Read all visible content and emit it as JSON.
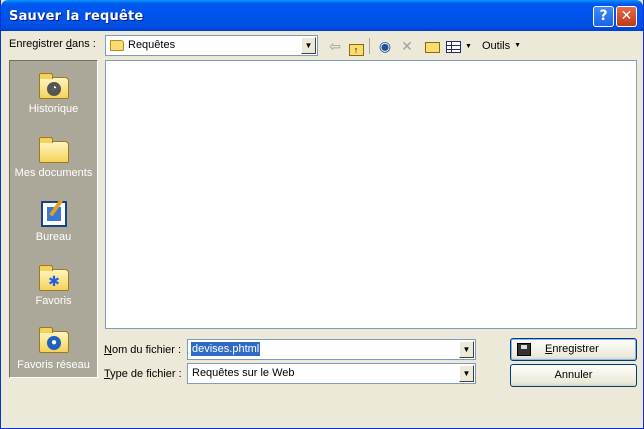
{
  "window": {
    "title": "Sauver la requête"
  },
  "titlebar_buttons": {
    "help": "?",
    "close": "✕"
  },
  "lookin": {
    "label_pre": "Enregistrer ",
    "label_key": "d",
    "label_post": "ans :",
    "value": "Requêtes"
  },
  "toolbar": {
    "tools_label": "Outils"
  },
  "places": [
    {
      "label": "Historique",
      "icon": "history-icon"
    },
    {
      "label": "Mes documents",
      "icon": "my-documents-icon"
    },
    {
      "label": "Bureau",
      "icon": "desktop-icon"
    },
    {
      "label": "Favoris",
      "icon": "favorites-icon"
    },
    {
      "label": "Favoris réseau",
      "icon": "network-favorites-icon"
    }
  ],
  "filename": {
    "label_key": "N",
    "label_post": "om du fichier :",
    "value": "devises.phtml"
  },
  "filetype": {
    "label_key": "T",
    "label_post": "ype de fichier :",
    "value": "Requêtes sur le Web"
  },
  "buttons": {
    "save_key": "E",
    "save_post": "nregistrer",
    "cancel": "Annuler"
  },
  "colors": {
    "titlebar": "#0053ee",
    "places_bg": "#aca899",
    "dialog_bg": "#ece9d8",
    "selection": "#316ac5"
  }
}
